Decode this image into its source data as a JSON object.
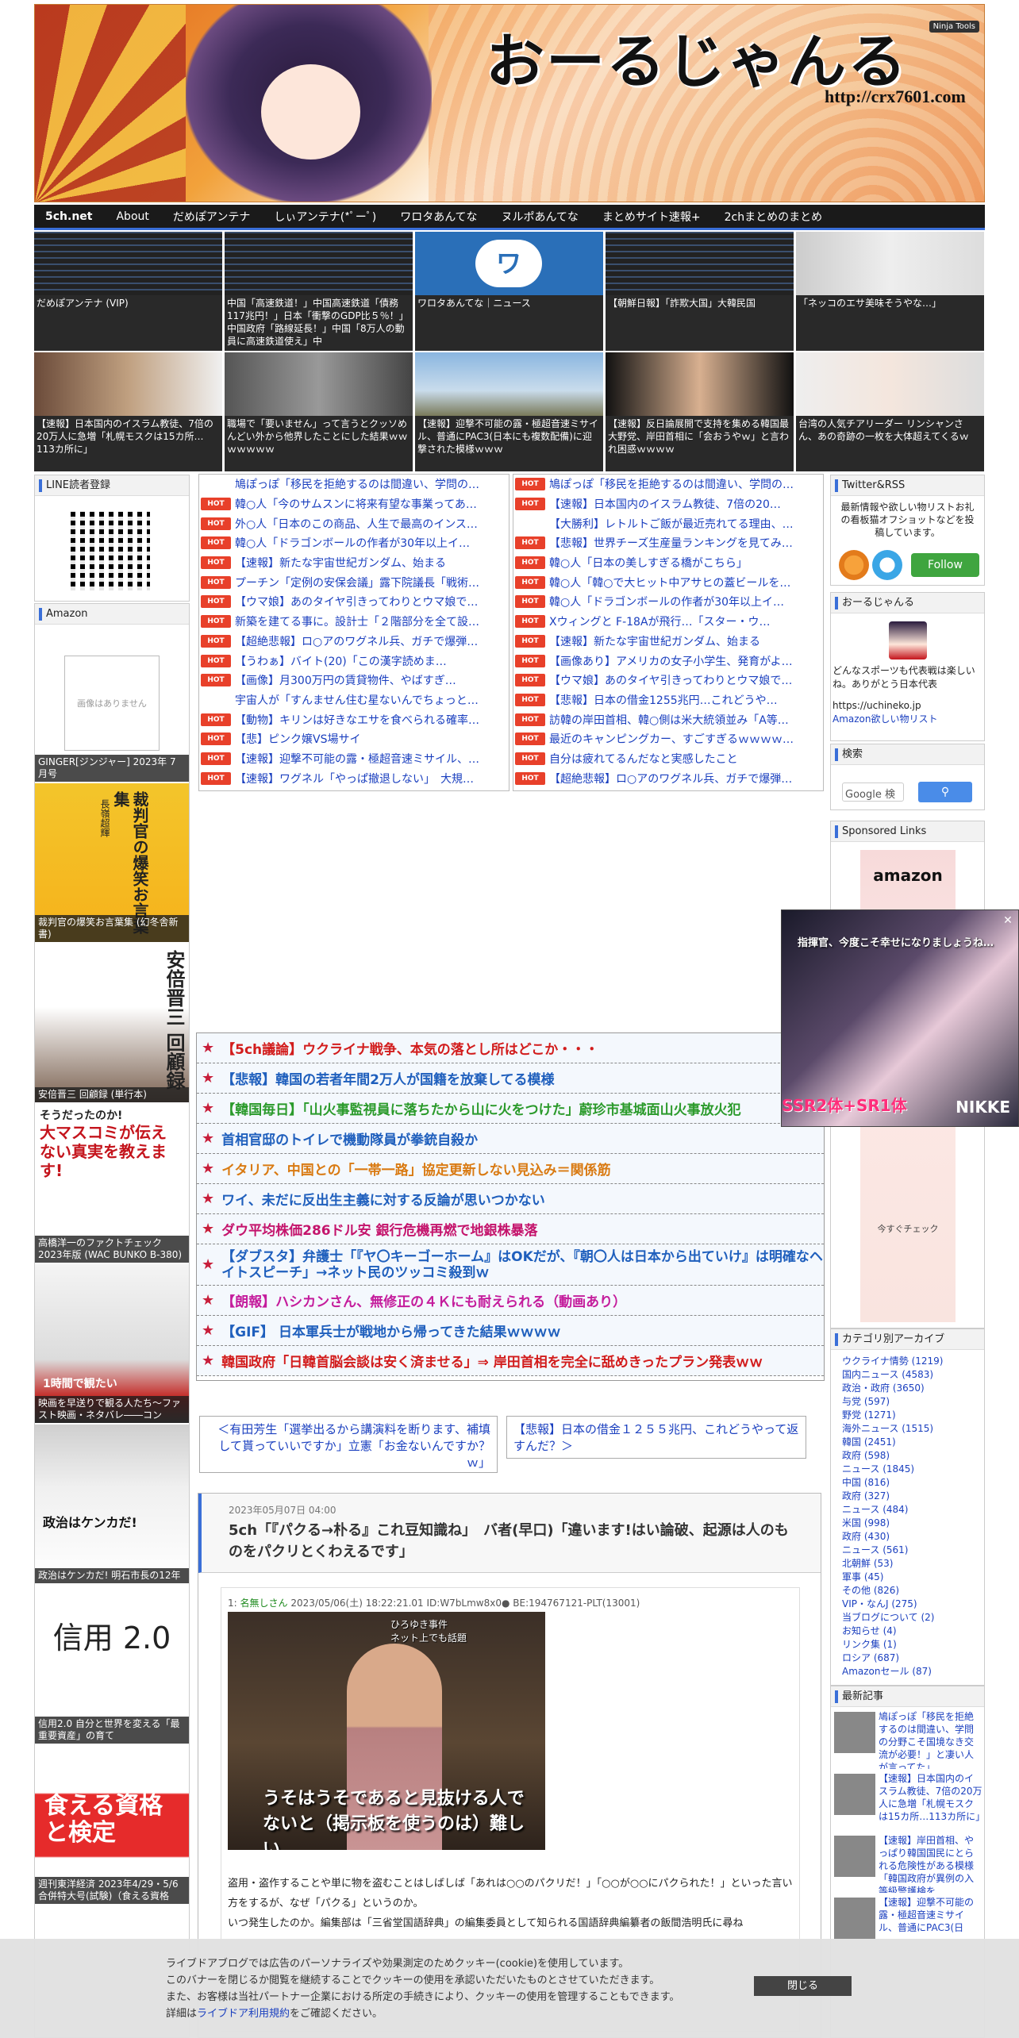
{
  "header": {
    "title": "おーるじゃんる",
    "url": "http://crx7601.com",
    "ninja_badge": "Ninja Tools"
  },
  "nav": [
    "5ch.net",
    "About",
    "だめぽアンテナ",
    "しぃアンテナ(*ﾟーﾟ)",
    "ワロタあんてな",
    "ヌルポあんてな",
    "まとめサイト速報+",
    "2chまとめのまとめ"
  ],
  "grid_row1": [
    "だめぽアンテナ (VIP)",
    "中国「高速鉄道！」中国高速鉄道「債務117兆円！」日本「衝撃のGDP比５％！」中国政府「路線延長！」中国「8万人の動員に高速鉄道使え」中",
    "ワロタあんてな｜ニュース",
    "【朝鮮日報】「詐欺大国」大韓民国",
    "「ネッコのエサ美味そうやな…」"
  ],
  "grid_row2": [
    "【速報】日本国内のイスラム教徒、7倍の20万人に急増「札幌モスクは15カ所…113カ所に」",
    "職場で「要いません」って言うとクッソめんどい外から他界したことにした結果ｗｗｗｗｗｗｗ",
    "【速報】迎撃不可能の露・極超音速ミサイル、普通にPAC3(日本にも複数配備)に迎撃された模様ｗｗｗ",
    "【速報】反日論展開で支持を集める韓国最大野党、岸田首相に「会おうやｗ」と言われ困惑ｗｗｗｗ",
    "台湾の人気チアリーダー リンシャンさん、あの奇跡の一枚を大体超えてくるｗ"
  ],
  "line_box": {
    "title": "LINE読者登録"
  },
  "amazon": {
    "title": "Amazon",
    "no_image_label": "画像はありません",
    "products": [
      "GINGER[ジンジャー] 2023年 7 月号",
      "裁判官の爆笑お言葉集 (幻冬舎新書)",
      "安倍晋三 回顧録 (単行本)",
      "高橋洋一のファクトチェック 2023年版 (WAC BUNKO B-380)",
      "映画を早送りで観る人たち～ファスト映画・ネタバレ――コン",
      "政治はケンカだ! 明石市長の12年",
      "信用2.0 自分と世界を変える「最重要資産」の育て",
      "週刊東洋経済 2023年4/29・5/6合併特大号(試験)（食える資格"
    ],
    "book_titles": {
      "saibankan": "裁判官の爆笑お言葉集",
      "saibankan_author": "長嶺超輝",
      "abe": "安倍晋三 回顧録",
      "factcheck_head": "そうだったのか!",
      "factcheck_body": "大マスコミが伝えない真実を教えます!",
      "fast_head": "1時間で観たい",
      "akashi": "政治はケンカだ!",
      "shinyo": "信用 2.0",
      "toyo": "食える資格と検定"
    }
  },
  "feed_left": [
    {
      "hot": false,
      "text": "鳩ぽっぽ「移民を拒絶するのは間違い、学問の…"
    },
    {
      "hot": true,
      "text": "韓○人「今のサムスンに将来有望な事業ってあ…"
    },
    {
      "hot": true,
      "text": "外○人「日本のこの商品、人生で最高のインス…"
    },
    {
      "hot": true,
      "text": "韓○人「ドラゴンボールの作者が30年以上イ…"
    },
    {
      "hot": true,
      "text": "【速報】新たな宇宙世紀ガンダム、始まる"
    },
    {
      "hot": true,
      "text": "プーチン「定例の安保会議」露下院議長「戦術…"
    },
    {
      "hot": true,
      "text": "【ウマ娘】あのタイヤ引きってわりとウマ娘で…"
    },
    {
      "hot": true,
      "text": "新築を建てる事に。設計士「２階部分を全て設…"
    },
    {
      "hot": true,
      "text": "【超絶悲報】ロ○アのワグネル兵、ガチで爆弾…"
    },
    {
      "hot": true,
      "text": "【うわぁ】バイト(20)「この漢字読めま…"
    },
    {
      "hot": true,
      "text": "【画像】月300万円の賃貸物件、やばすぎ…"
    },
    {
      "hot": false,
      "text": "宇宙人が「すんません住む星ないんでちょっと…"
    },
    {
      "hot": true,
      "text": "【動物】キリンは好きなエサを食べられる確率…"
    },
    {
      "hot": true,
      "text": "【悲】ピンク嬢VS場サイ"
    },
    {
      "hot": true,
      "text": "【速報】迎撃不可能の露・極超音速ミサイル、…"
    },
    {
      "hot": true,
      "text": "【速報】ワグネル「やっぱ撤退しない」　大規…"
    }
  ],
  "feed_right": [
    {
      "hot": true,
      "text": "鳩ぽっぽ「移民を拒絶するのは間違い、学問の…"
    },
    {
      "hot": true,
      "text": "【速報】日本国内のイスラム教徒、7倍の20…"
    },
    {
      "hot": false,
      "text": "【大勝利】レトルトご飯が最近売れてる理由、…"
    },
    {
      "hot": true,
      "text": "【悲報】世界チーズ生産量ランキングを見てみ…"
    },
    {
      "hot": true,
      "text": "韓○人「日本の美しすぎる橋がこちら」"
    },
    {
      "hot": true,
      "text": "韓○人「韓○で大ヒット中アサヒの蓋ビールを…"
    },
    {
      "hot": true,
      "text": "韓○人「ドラゴンボールの作者が30年以上イ…"
    },
    {
      "hot": true,
      "text": "Xウィングと F-18Aが飛行…「スター・ウ…"
    },
    {
      "hot": true,
      "text": "【速報】新たな宇宙世紀ガンダム、始まる"
    },
    {
      "hot": true,
      "text": "【画像あり】アメリカの女子小学生、発育がよ…"
    },
    {
      "hot": true,
      "text": "【ウマ娘】あのタイヤ引きってわりとウマ娘で…"
    },
    {
      "hot": true,
      "text": "【悲報】日本の借金1255兆円…これどうや…"
    },
    {
      "hot": true,
      "text": "訪韓の岸田首相、韓○側は米大統領並み「A等…"
    },
    {
      "hot": true,
      "text": "最近のキャンピングカー、すごすぎるｗｗｗｗ…"
    },
    {
      "hot": true,
      "text": "自分は疲れてるんだなと実感したこと"
    },
    {
      "hot": true,
      "text": "【超絶悲報】ロ○アのワグネル兵、ガチで爆弾…"
    }
  ],
  "headlines": [
    {
      "text": "【5ch議論】ウクライナ戦争、本気の落とし所はどこか・・・",
      "color": "#d21c1c"
    },
    {
      "text": "【悲報】韓国の若者年間2万人が国籍を放棄してる模様",
      "color": "#1f5fbd"
    },
    {
      "text": "【韓国毎日】「山火事監視員に落ちたから山に火をつけた」蔚珍市基城面山火事放火犯",
      "color": "#2b9a2b"
    },
    {
      "text": "首相官邸のトイレで機動隊員が拳銃自殺か",
      "color": "#1f5fbd"
    },
    {
      "text": "イタリア、中国との「一帯一路」協定更新しない見込み＝関係筋",
      "color": "#d97a12"
    },
    {
      "text": "ワイ、未だに反出生主義に対する反論が思いつかない",
      "color": "#1f5fbd"
    },
    {
      "text": "ダウ平均株価286ドル安 銀行危機再燃で地銀株暴落",
      "color": "#c4146c"
    },
    {
      "text": "【ダブスタ】弁護士「『ヤ〇キーゴーホーム』はOKだが、『朝〇人は日本から出ていけ』は明確なヘイトスピーチ」→ネット民のツッコミ殺到ｗ",
      "color": "#1f5fbd"
    },
    {
      "text": "【朗報】ハシカンさん、無修正の４Ｋにも耐えられる（動画あり）",
      "color": "#c41c9c"
    },
    {
      "text": "【GIF】 日本軍兵士が戦地から帰ってきた結果ｗｗｗｗ",
      "color": "#1f5fbd"
    },
    {
      "text": "韓国政府「日韓首脳会談は安く済ませる」⇒ 岸田首相を完全に舐めきったプラン発表ｗｗ",
      "color": "#d21c1c"
    }
  ],
  "pager": {
    "prev": "＜有田芳生「選挙出るから講演料を断ります、補填して貰っていいですか」立憲「お金ないんですか？ｗ」",
    "next": "【悲報】日本の借金１２５５兆円、これどうやって返すんだ？＞"
  },
  "article": {
    "date": "2023年05月07日 04:00",
    "title": "5ch「『パクる→朴る』これ豆知識ね」　バ者(早口)「違います!はい論破、起源は人のものをパクリとくわえるです」",
    "post_number": "1:",
    "post_name": "名無しさん",
    "post_meta": "2023/05/06(土) 18:22:21.01 ID:W7bLmw8x0● BE:194767121-PLT(13001)",
    "image_top_caption": "ひろゆき事件\nネット上でも話題",
    "image_caption": "うそはうそであると見抜ける人でないと（掲示板を使うのは）難しい",
    "body_line1": "盗用・盗作することや単に物を盗むことはしばしば「あれは○○のパクリだ！」「○○が○○にパクられた！」といった言い方をするが、なぜ「パクる」というのか。",
    "body_line2": "いつ発生したのか。編集部は「三省堂国語辞典」の編集委員として知られる国語辞典編纂者の飯間浩明氏に尋ね"
  },
  "rss": {
    "title": "Twitter&RSS",
    "text": "最新情報や欲しい物リストお礼の看板猫オフショットなどを投稿しています。",
    "follow_label": "Follow"
  },
  "about": {
    "title": "おーるじゃんる",
    "text": "どんなスポーツも代表戦は楽しいね。ありがとう日本代表",
    "link": "https://uchineko.jp",
    "wishlist": "Amazon欲しい物リスト"
  },
  "search": {
    "title": "検索",
    "placeholder": "Google 検",
    "button_icon": "search-icon"
  },
  "sponsored": {
    "title": "Sponsored Links",
    "logo": "amazon",
    "check": "今すぐチェック"
  },
  "categories": {
    "title": "カテゴリ別アーカイブ",
    "items": [
      "ウクライナ情勢 (1219)",
      "国内ニュース (4583)",
      "政治・政府 (3650)",
      "与党 (597)",
      "野党 (1271)",
      "海外ニュース (1515)",
      "韓国 (2451)",
      "政府 (598)",
      "ニュース (1845)",
      "中国 (816)",
      "政府 (327)",
      "ニュース (484)",
      "米国 (998)",
      "政府 (430)",
      "ニュース (561)",
      "北朝鮮 (53)",
      "軍事 (45)",
      "その他 (826)",
      "VIP・なんJ (275)",
      "当ブログについて (2)",
      "お知らせ (4)",
      "リンク集 (1)",
      "ロシア (687)",
      "Amazonセール (87)"
    ]
  },
  "recent": {
    "title": "最新記事",
    "items": [
      "鳩ぽっぽ「移民を拒絶するのは間違い、学問の分野こそ国境なき交流が必要！」と凄い人が言ってた」",
      "【速報】日本国内のイスラム教徒、7倍の20万人に急増「札幌モスクは15カ所…113カ所に」",
      "【速報】岸田首相、やっぱり韓国国民にとられる危険性がある模様「韓国政府が異例の入等級警護検を",
      "【速報】迎撃不可能の露・極超音速ミサイル、普通にPAC3(日"
    ]
  },
  "float_ad": {
    "top_text": "指揮官、今度こそ幸せになりましょうね…",
    "ssr_text": "SSR2体+SR1体",
    "brand": "NIKKE",
    "close": "✕"
  },
  "cookie": {
    "line1": "ライブドアブログでは広告のパーソナライズや効果測定のためクッキー(cookie)を使用しています。",
    "line2": "このバナーを閉じるか閲覧を継続することでクッキーの使用を承認いただいたものとさせていただきます。",
    "line3": "また、お客様は当社パートナー企業における所定の手続きにより、クッキーの使用を管理することもできます。",
    "line4_prefix": "詳細は",
    "line4_link": "ライブドア利用規約",
    "line4_suffix": "をご確認ください。",
    "close_label": "閉じる"
  },
  "colors": {
    "accent_blue": "#3a6fd8",
    "link_blue": "#1a3fbf",
    "hot_red": "#e8402a",
    "nav_bg": "#1a1a1a"
  }
}
